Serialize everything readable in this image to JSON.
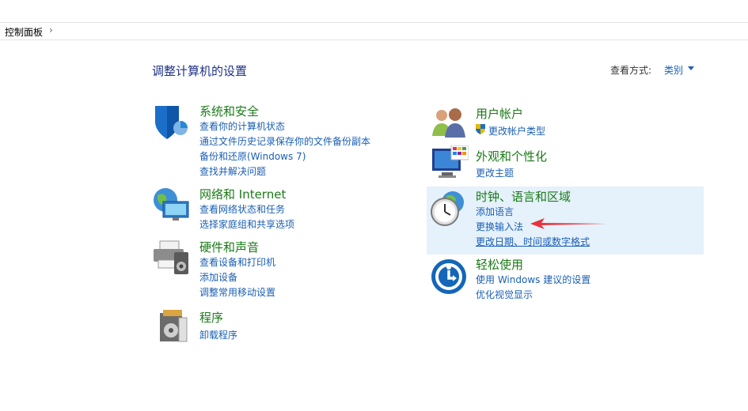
{
  "breadcrumb": {
    "root": "控制面板",
    "arrow": "›"
  },
  "page_title": "调整计算机的设置",
  "view_by": {
    "label": "查看方式:",
    "value": "类别"
  },
  "categories": {
    "system": {
      "title": "系统和安全",
      "links": [
        "查看你的计算机状态",
        "通过文件历史记录保存你的文件备份副本",
        "备份和还原(Windows 7)",
        "查找并解决问题"
      ]
    },
    "network": {
      "title": "网络和 Internet",
      "links": [
        "查看网络状态和任务",
        "选择家庭组和共享选项"
      ]
    },
    "hardware": {
      "title": "硬件和声音",
      "links": [
        "查看设备和打印机",
        "添加设备",
        "调整常用移动设置"
      ]
    },
    "programs": {
      "title": "程序",
      "links": [
        "卸载程序"
      ]
    },
    "accounts": {
      "title": "用户帐户",
      "links": [
        "更改帐户类型"
      ]
    },
    "appearance": {
      "title": "外观和个性化",
      "links": [
        "更改主题"
      ]
    },
    "clock": {
      "title": "时钟、语言和区域",
      "links": [
        "添加语言",
        "更换输入法",
        "更改日期、时间或数字格式"
      ]
    },
    "ease": {
      "title": "轻松使用",
      "links": [
        "使用 Windows 建议的设置",
        "优化视觉显示"
      ]
    }
  },
  "colors": {
    "heading": "#1a7a17",
    "link": "#1a5fb4",
    "title": "#1e3287",
    "hover_bg": "#e5f1fb",
    "arrow": "#e8323c"
  }
}
